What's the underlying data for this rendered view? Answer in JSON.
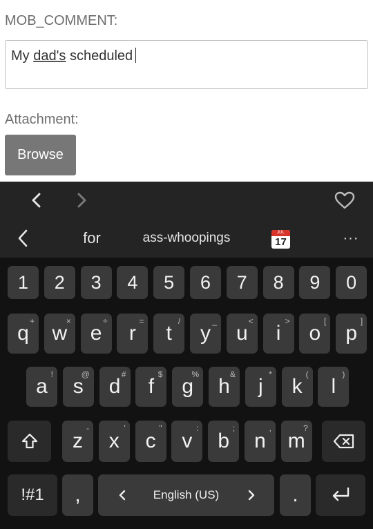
{
  "form": {
    "comment_label": "MOB_COMMENT:",
    "comment_value_prefix": "My ",
    "comment_value_underlined": "dad's",
    "comment_value_suffix": " scheduled",
    "attachment_label": "Attachment:",
    "browse_label": "Browse"
  },
  "keyboard": {
    "toolbar": {
      "icons": [
        "chevron-left-icon",
        "chevron-right-icon",
        "heart-icon"
      ]
    },
    "suggestions": {
      "words": [
        "for",
        "ass-whoopings"
      ],
      "emoji_icon": "calendar-icon",
      "calendar_month": "JUL",
      "calendar_day": "17",
      "more_label": "···"
    },
    "number_row": [
      "1",
      "2",
      "3",
      "4",
      "5",
      "6",
      "7",
      "8",
      "9",
      "0"
    ],
    "row1": [
      {
        "key": "q",
        "sup": "+"
      },
      {
        "key": "w",
        "sup": "×"
      },
      {
        "key": "e",
        "sup": "÷"
      },
      {
        "key": "r",
        "sup": "="
      },
      {
        "key": "t",
        "sup": "/"
      },
      {
        "key": "y",
        "sup": "_"
      },
      {
        "key": "u",
        "sup": "<"
      },
      {
        "key": "i",
        "sup": ">"
      },
      {
        "key": "o",
        "sup": "["
      },
      {
        "key": "p",
        "sup": "]"
      }
    ],
    "row2": [
      {
        "key": "a",
        "sup": "!"
      },
      {
        "key": "s",
        "sup": "@"
      },
      {
        "key": "d",
        "sup": "#"
      },
      {
        "key": "f",
        "sup": "$"
      },
      {
        "key": "g",
        "sup": "%"
      },
      {
        "key": "h",
        "sup": "&"
      },
      {
        "key": "j",
        "sup": "*"
      },
      {
        "key": "k",
        "sup": "("
      },
      {
        "key": "l",
        "sup": ")"
      }
    ],
    "row3": [
      {
        "key": "z",
        "sup": "-"
      },
      {
        "key": "x",
        "sup": "'"
      },
      {
        "key": "c",
        "sup": "\""
      },
      {
        "key": "v",
        "sup": ":"
      },
      {
        "key": "b",
        "sup": ";"
      },
      {
        "key": "n",
        "sup": ","
      },
      {
        "key": "m",
        "sup": "?"
      }
    ],
    "symbols_label": "!#1",
    "comma_label": ",",
    "space_label": "English (US)",
    "period_label": ".",
    "colors": {
      "background": "#121212",
      "key": "#3a3a3a",
      "key_dark": "#2a2a2a",
      "bar": "#242424"
    }
  }
}
